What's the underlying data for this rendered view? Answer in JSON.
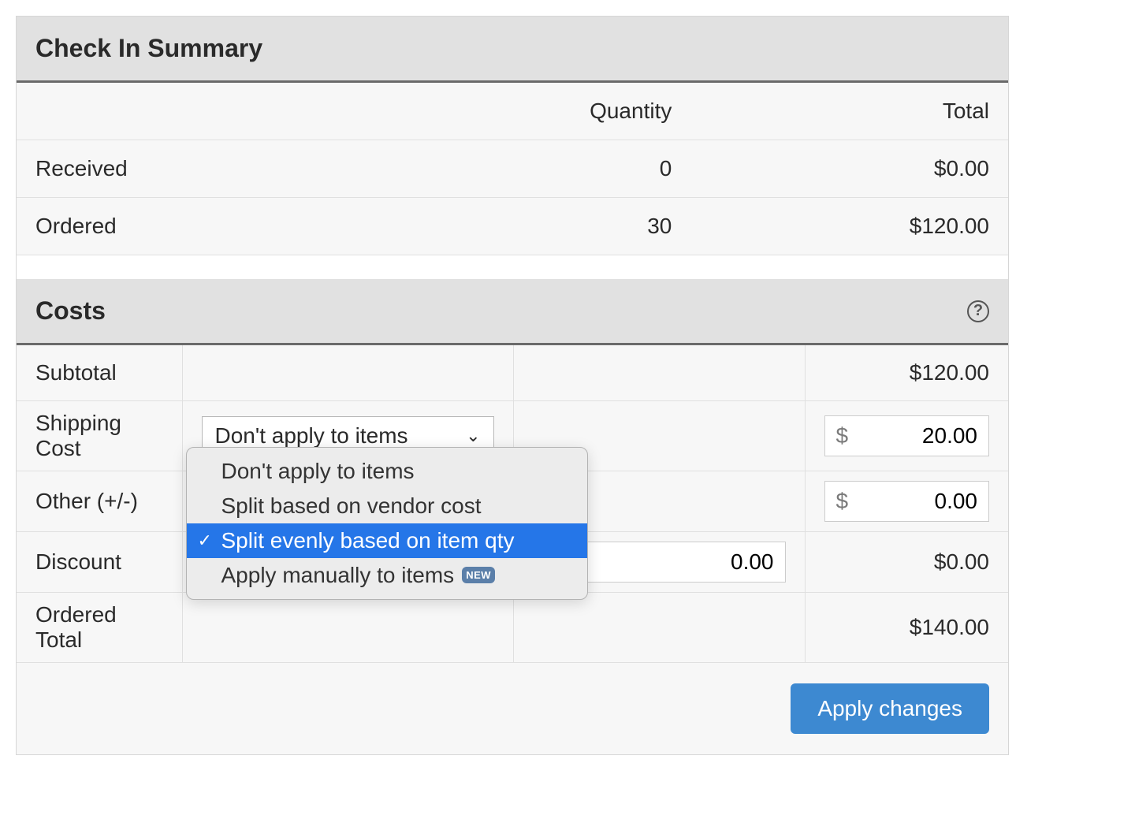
{
  "summary": {
    "title": "Check In Summary",
    "cols": {
      "qty": "Quantity",
      "total": "Total"
    },
    "rows": [
      {
        "label": "Received",
        "qty": "0",
        "total": "$0.00"
      },
      {
        "label": "Ordered",
        "qty": "30",
        "total": "$120.00"
      }
    ]
  },
  "costs": {
    "title": "Costs",
    "subtotal": {
      "label": "Subtotal",
      "value": "$120.00"
    },
    "shipping": {
      "label": "Shipping Cost",
      "select_value": "Don't apply to items",
      "currency": "$",
      "amount": "20.00",
      "options": [
        {
          "label": "Don't apply to items",
          "checked": false,
          "new": false
        },
        {
          "label": "Split based on vendor cost",
          "checked": false,
          "new": false
        },
        {
          "label": "Split evenly based on item qty",
          "checked": true,
          "new": false
        },
        {
          "label": "Apply manually to items",
          "checked": false,
          "new": true
        }
      ],
      "new_badge": "NEW"
    },
    "other": {
      "label": "Other (+/-)",
      "currency": "$",
      "amount": "0.00"
    },
    "discount": {
      "label": "Discount",
      "input_value": "0.00",
      "value": "$0.00"
    },
    "ordered_total": {
      "label": "Ordered Total",
      "value": "$140.00"
    },
    "apply_button": "Apply changes"
  }
}
